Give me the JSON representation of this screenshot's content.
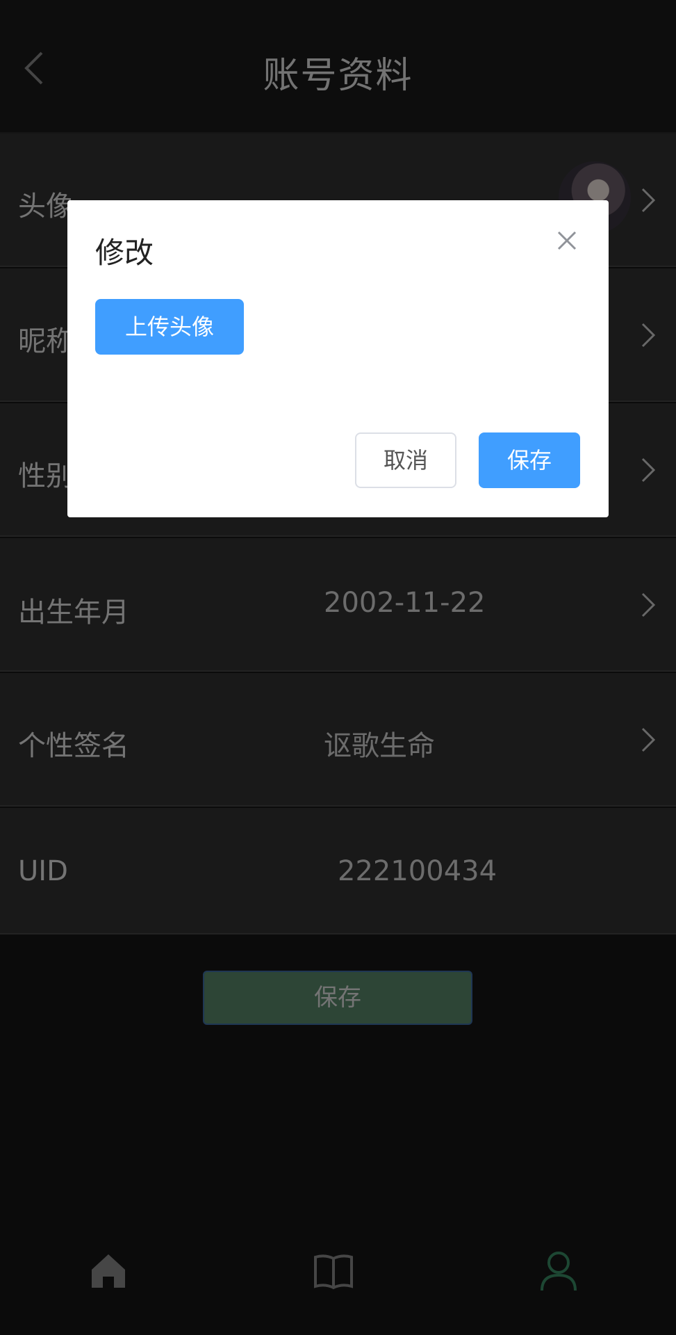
{
  "header": {
    "title": "账号资料"
  },
  "rows": [
    {
      "label": "头像",
      "value": ""
    },
    {
      "label": "昵称",
      "value": ""
    },
    {
      "label": "性别",
      "value": ""
    },
    {
      "label": "出生年月",
      "value": "2002-11-22"
    },
    {
      "label": "个性签名",
      "value": "讴歌生命"
    },
    {
      "label": "UID",
      "value": "222100434"
    }
  ],
  "main": {
    "save_label": "保存"
  },
  "tabbar": {
    "tabs": [
      "home-icon",
      "book-icon",
      "profile-icon"
    ],
    "active": "profile-icon"
  },
  "dialog": {
    "title": "修改",
    "upload_label": "上传头像",
    "cancel_label": "取消",
    "save_label": "保存"
  },
  "colors": {
    "primary": "#409eff",
    "active_tab": "#3a8f66",
    "save_button": "#5a8a6c"
  }
}
